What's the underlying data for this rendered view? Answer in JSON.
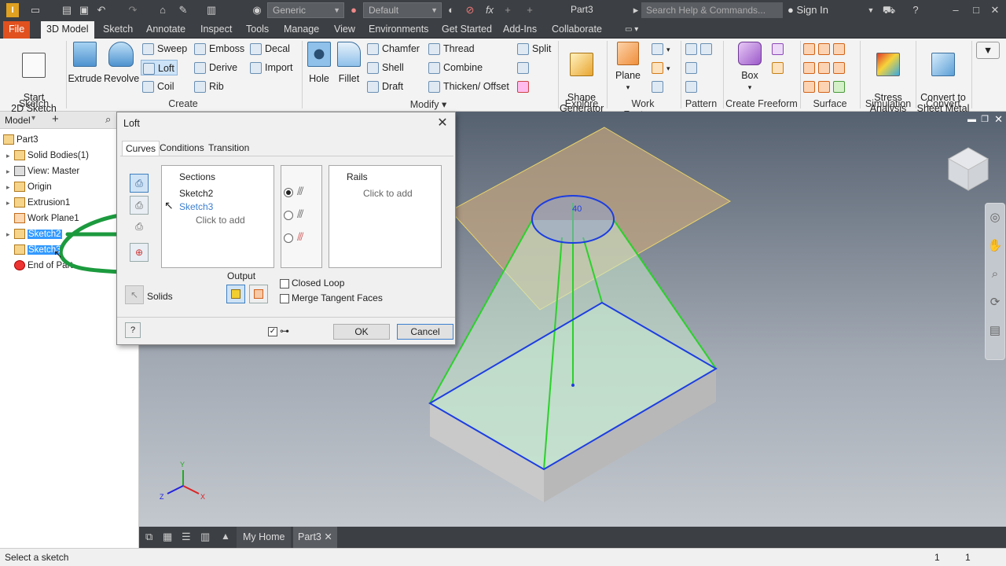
{
  "app": {
    "title": "Part3",
    "search_placeholder": "Search Help & Commands...",
    "sign_in": "Sign In",
    "material": "Generic",
    "appearance": "Default",
    "fx": "fx"
  },
  "tabs": [
    "File",
    "3D Model",
    "Sketch",
    "Annotate",
    "Inspect",
    "Tools",
    "Manage",
    "View",
    "Environments",
    "Get Started",
    "Add-Ins",
    "Collaborate"
  ],
  "ribbon": {
    "start_sketch": "Start\n2D Sketch",
    "extrude": "Extrude",
    "revolve": "Revolve",
    "sweep": "Sweep",
    "loft": "Loft",
    "coil": "Coil",
    "emboss": "Emboss",
    "derive": "Derive",
    "rib": "Rib",
    "decal": "Decal",
    "import": "Import",
    "hole": "Hole",
    "fillet": "Fillet",
    "chamfer": "Chamfer",
    "shell": "Shell",
    "draft": "Draft",
    "thread": "Thread",
    "combine": "Combine",
    "thicken": "Thicken/ Offset",
    "split": "Split",
    "shape_gen": "Shape\nGenerator",
    "plane": "Plane",
    "box": "Box",
    "stress": "Stress\nAnalysis",
    "convert": "Convert to\nSheet Metal",
    "groups": {
      "sketch": "Sketch",
      "create": "Create",
      "modify": "Modify ▾",
      "explore": "Explore",
      "work": "Work Features",
      "pattern": "Pattern",
      "freeform": "Create Freeform",
      "surface": "Surface",
      "simulation": "Simulation",
      "convert": "Convert"
    }
  },
  "browser": {
    "title": "Model",
    "items": [
      "Part3",
      "Solid Bodies(1)",
      "View: Master",
      "Origin",
      "Extrusion1",
      "Work Plane1",
      "Sketch2",
      "Sketch3",
      "End of Part"
    ]
  },
  "dialog": {
    "title": "Loft",
    "tabs": [
      "Curves",
      "Conditions",
      "Transition"
    ],
    "sections_header": "Sections",
    "sections": [
      "Sketch2",
      "Sketch3"
    ],
    "click_to_add": "Click to add",
    "rails_header": "Rails",
    "rails_add": "Click to add",
    "output_label": "Output",
    "solids": "Solids",
    "closed_loop": "Closed Loop",
    "merge_tangent": "Merge Tangent Faces",
    "ok": "OK",
    "cancel": "Cancel"
  },
  "viewport": {
    "dim": "40",
    "tabs": [
      "My Home",
      "Part3"
    ]
  },
  "status": {
    "message": "Select a sketch",
    "c1": "1",
    "c2": "1"
  }
}
